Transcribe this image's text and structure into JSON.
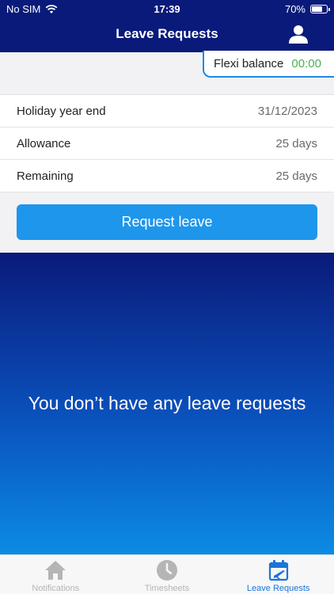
{
  "status_bar": {
    "carrier": "No SIM",
    "time": "17:39",
    "battery": "70%",
    "battery_level": 0.7
  },
  "header": {
    "title": "Leave Requests",
    "profile_icon": "person-icon"
  },
  "flexi": {
    "label": "Flexi balance",
    "value": "00:00",
    "value_color": "#4caf50"
  },
  "info": [
    {
      "label": "Holiday year end",
      "value": "31/12/2023"
    },
    {
      "label": "Allowance",
      "value": "25 days"
    },
    {
      "label": "Remaining",
      "value": "25 days"
    }
  ],
  "actions": {
    "request_label": "Request leave"
  },
  "empty_state": {
    "message": "You don’t have any leave requests"
  },
  "tabs": [
    {
      "label": "Notifications",
      "icon": "home-icon",
      "active": false
    },
    {
      "label": "Timesheets",
      "icon": "clock-icon",
      "active": false
    },
    {
      "label": "Leave Requests",
      "icon": "calendar-plane-icon",
      "active": true
    }
  ],
  "colors": {
    "header_bg": "#0a1a7a",
    "accent": "#1e96ec",
    "active_tab": "#1a75d8",
    "inactive_tab": "#b5b5b5"
  }
}
